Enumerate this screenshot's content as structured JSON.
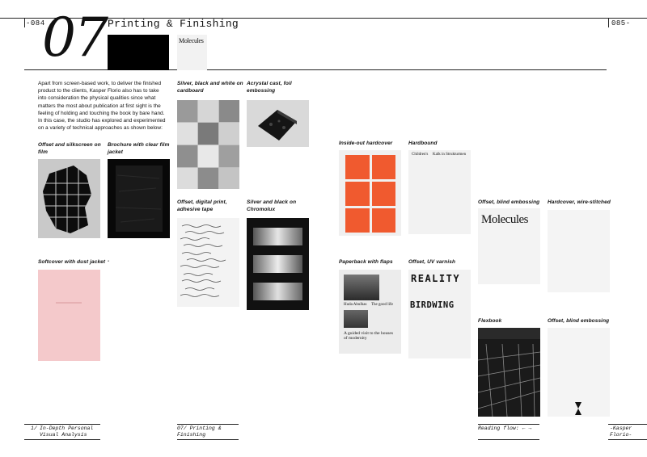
{
  "header": {
    "left_page": "-084",
    "right_page": "085-",
    "chapter_number": "07",
    "section_title": "Printing & Finishing",
    "thumb_word": "Molecules"
  },
  "intro": "Apart from screen-based work, to deliver the finished product to the clients, Kasper Florio also has to take into consideration the physical qualities since what matters the most about publication at first sight is the feeling of holding and touching the book by bare hand. In this case, the studio has explored and experimented on a variety of technical approaches as shown below:",
  "items": {
    "offset_silkscreen": "Offset and silkscreen on film",
    "brochure_film": "Brochure with clear film jacket",
    "softcover_dust": "Softcover with dust jacket",
    "softcover_dash": "-",
    "silver_black_white": "Silver, black and white on cardboard",
    "acrystal": "Acrystal cast, foil embossing",
    "offset_digital": "Offset, digital print, adhesive tape",
    "silver_black_chromolux": "Silver and black on Chromolux",
    "inside_out": "Inside-out hardcover",
    "hardbound": "Hardbound",
    "paperback_flaps": "Paperback with flaps",
    "offset_uv": "Offset, UV varnish",
    "offset_blind_1": "Offset, blind embossing",
    "hardcover_wire": "Hardcover, wire-stitched",
    "flexbook": "Flexbook",
    "offset_blind_2": "Offset, blind embossing"
  },
  "covers": {
    "molecules": "Molecules",
    "childrens": "Children's",
    "kalk": "Kalk in Strukturmen",
    "reality": "REALITY",
    "birdwing": "BIRDWING",
    "paperback_top": "Huda Abulhas",
    "paperback_title": "The good life",
    "paperback_sub": "A guided visit to the houses of modernity"
  },
  "footer": {
    "left_num": "1/",
    "left_text": "In-Depth Personal Visual Analysis",
    "center": "07/ Printing & Finishing",
    "reading": "Reading flow: ← →",
    "right": "-Kasper Florio-"
  },
  "colors": {
    "orange": "#f05a2f",
    "pink": "#f4c9cb",
    "rule": "#222222"
  }
}
